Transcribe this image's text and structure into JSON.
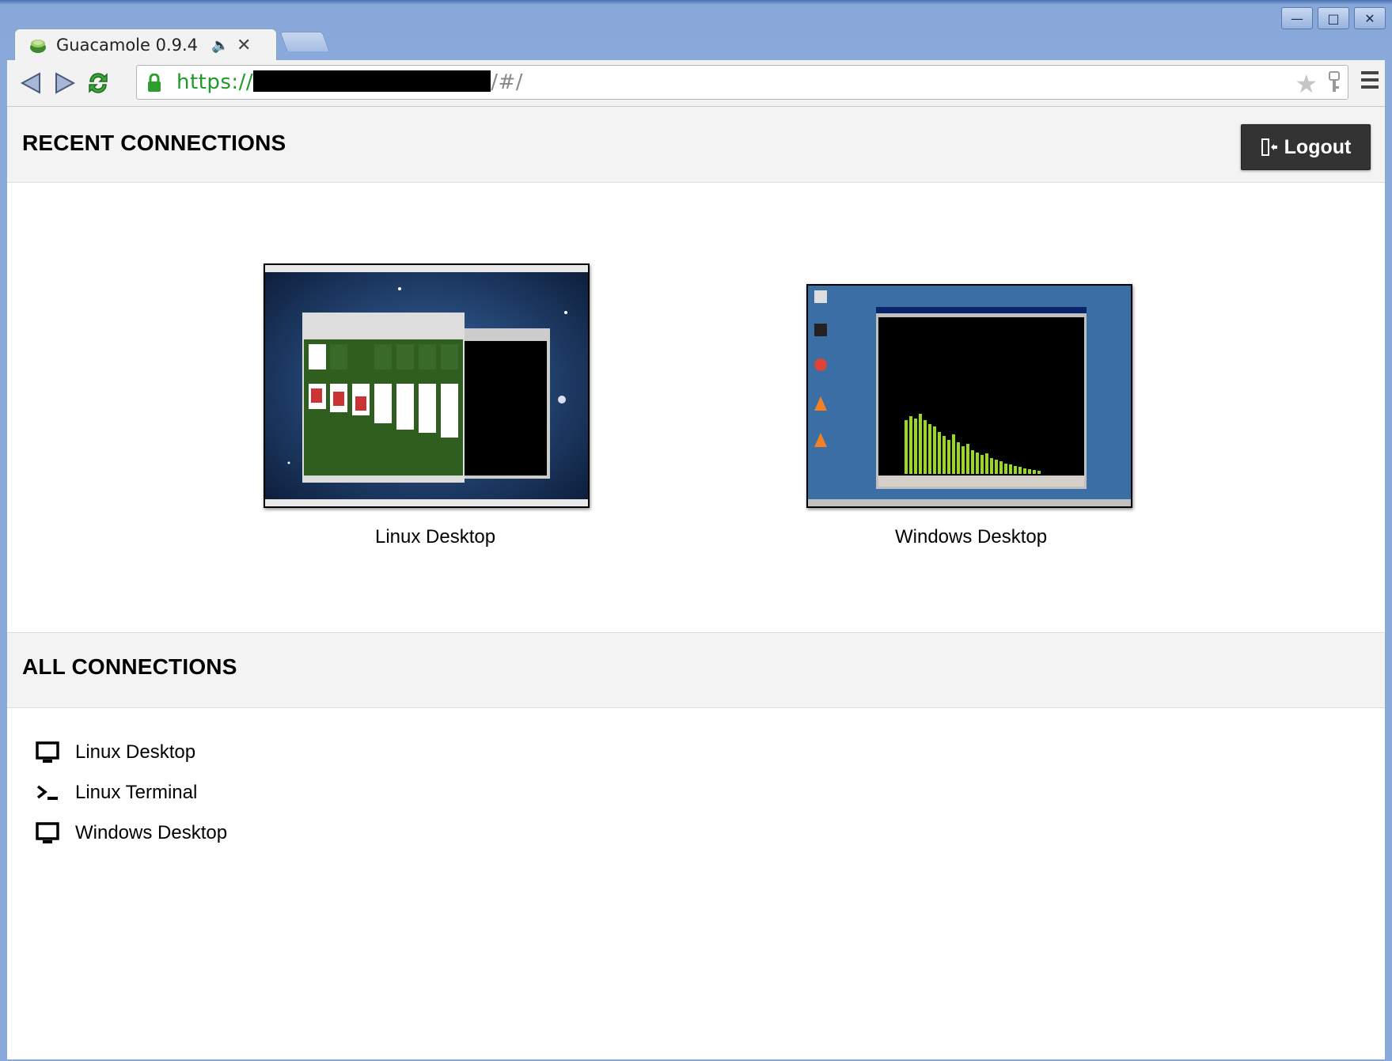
{
  "browser": {
    "tab_title": "Guacamole 0.9.4",
    "tab_mute_icon": "speaker-mute-icon",
    "tab_close_icon": "close-icon",
    "url_scheme": "https://",
    "url_path": "/#/",
    "window_controls": [
      "minimize-icon",
      "maximize-icon",
      "close-icon"
    ]
  },
  "header": {
    "title": "RECENT CONNECTIONS",
    "logout_label": "Logout"
  },
  "recent": [
    {
      "name": "Linux Desktop"
    },
    {
      "name": "Windows Desktop"
    }
  ],
  "all_connections": {
    "title": "ALL CONNECTIONS",
    "items": [
      {
        "name": "Linux Desktop",
        "icon": "desktop-icon"
      },
      {
        "name": "Linux Terminal",
        "icon": "terminal-icon"
      },
      {
        "name": "Windows Desktop",
        "icon": "desktop-icon"
      }
    ]
  }
}
